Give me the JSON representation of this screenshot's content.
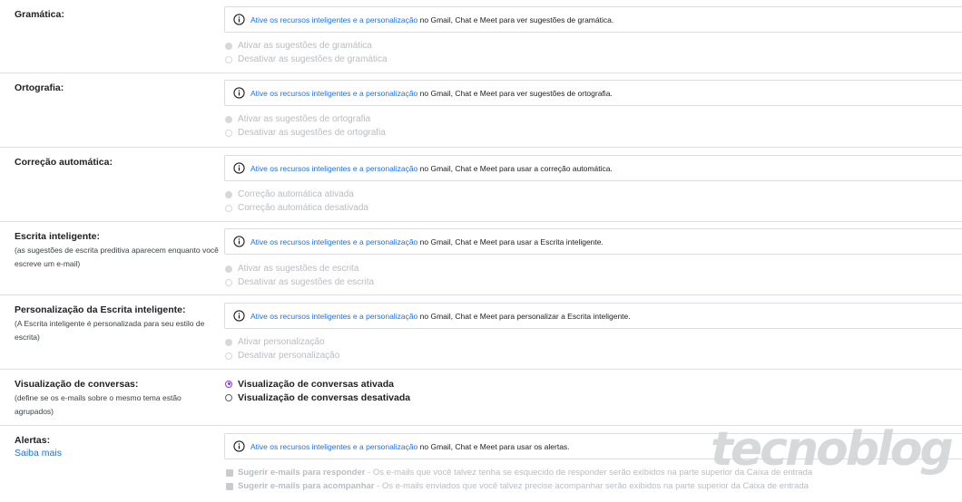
{
  "notice": {
    "link_text": "Ative os recursos inteligentes e a personalização",
    "prefix": " no Gmail, Chat e Meet para "
  },
  "sections": {
    "grammar": {
      "title": "Gramática:",
      "notice_suffix": "ver sugestões de gramática.",
      "options": [
        "Ativar as sugestões de gramática",
        "Desativar as sugestões de gramática"
      ]
    },
    "spelling": {
      "title": "Ortografia:",
      "notice_suffix": "ver sugestões de ortografia.",
      "options": [
        "Ativar as sugestões de ortografia",
        "Desativar as sugestões de ortografia"
      ]
    },
    "autocorrect": {
      "title": "Correção automática:",
      "notice_suffix": "usar a correção automática.",
      "options": [
        "Correção automática ativada",
        "Correção automática desativada"
      ]
    },
    "smart_compose": {
      "title": "Escrita inteligente:",
      "subtitle": "(as sugestões de escrita preditiva aparecem enquanto você escreve um e-mail)",
      "notice_suffix": "usar a Escrita inteligente.",
      "options": [
        "Ativar as sugestões de escrita",
        "Desativar as sugestões de escrita"
      ]
    },
    "smart_compose_personalization": {
      "title": "Personalização da Escrita inteligente:",
      "subtitle": "(A Escrita inteligente é personalizada para seu estilo de escrita)",
      "notice_suffix": "personalizar a Escrita inteligente.",
      "options": [
        "Ativar personalização",
        "Desativar personalização"
      ]
    },
    "conversation_view": {
      "title": "Visualização de conversas:",
      "subtitle": "(define se os e-mails sobre o mesmo tema estão agrupados)",
      "options": [
        "Visualização de conversas ativada",
        "Visualização de conversas desativada"
      ],
      "selected": 0
    },
    "nudges": {
      "title": "Alertas:",
      "learn_more": "Saiba mais",
      "notice_suffix": "usar os alertas.",
      "checks": [
        {
          "bold": "Sugerir e-mails para responder",
          "rest": " - Os e-mails que você talvez tenha se esquecido de responder serão exibidos na parte superior da Caixa de entrada"
        },
        {
          "bold": "Sugerir e-mails para acompanhar",
          "rest": " - Os e-mails enviados que você talvez precise acompanhar serão exibidos na parte superior da Caixa de entrada"
        }
      ]
    }
  },
  "watermark": "tecnoblog",
  "colors": {
    "link": "#1a73e8",
    "radio_selected": "#9334e6",
    "disabled_text": "#b9bcc0",
    "divider": "#e0e0e0"
  },
  "icons": {
    "info": "info-circle-icon"
  }
}
